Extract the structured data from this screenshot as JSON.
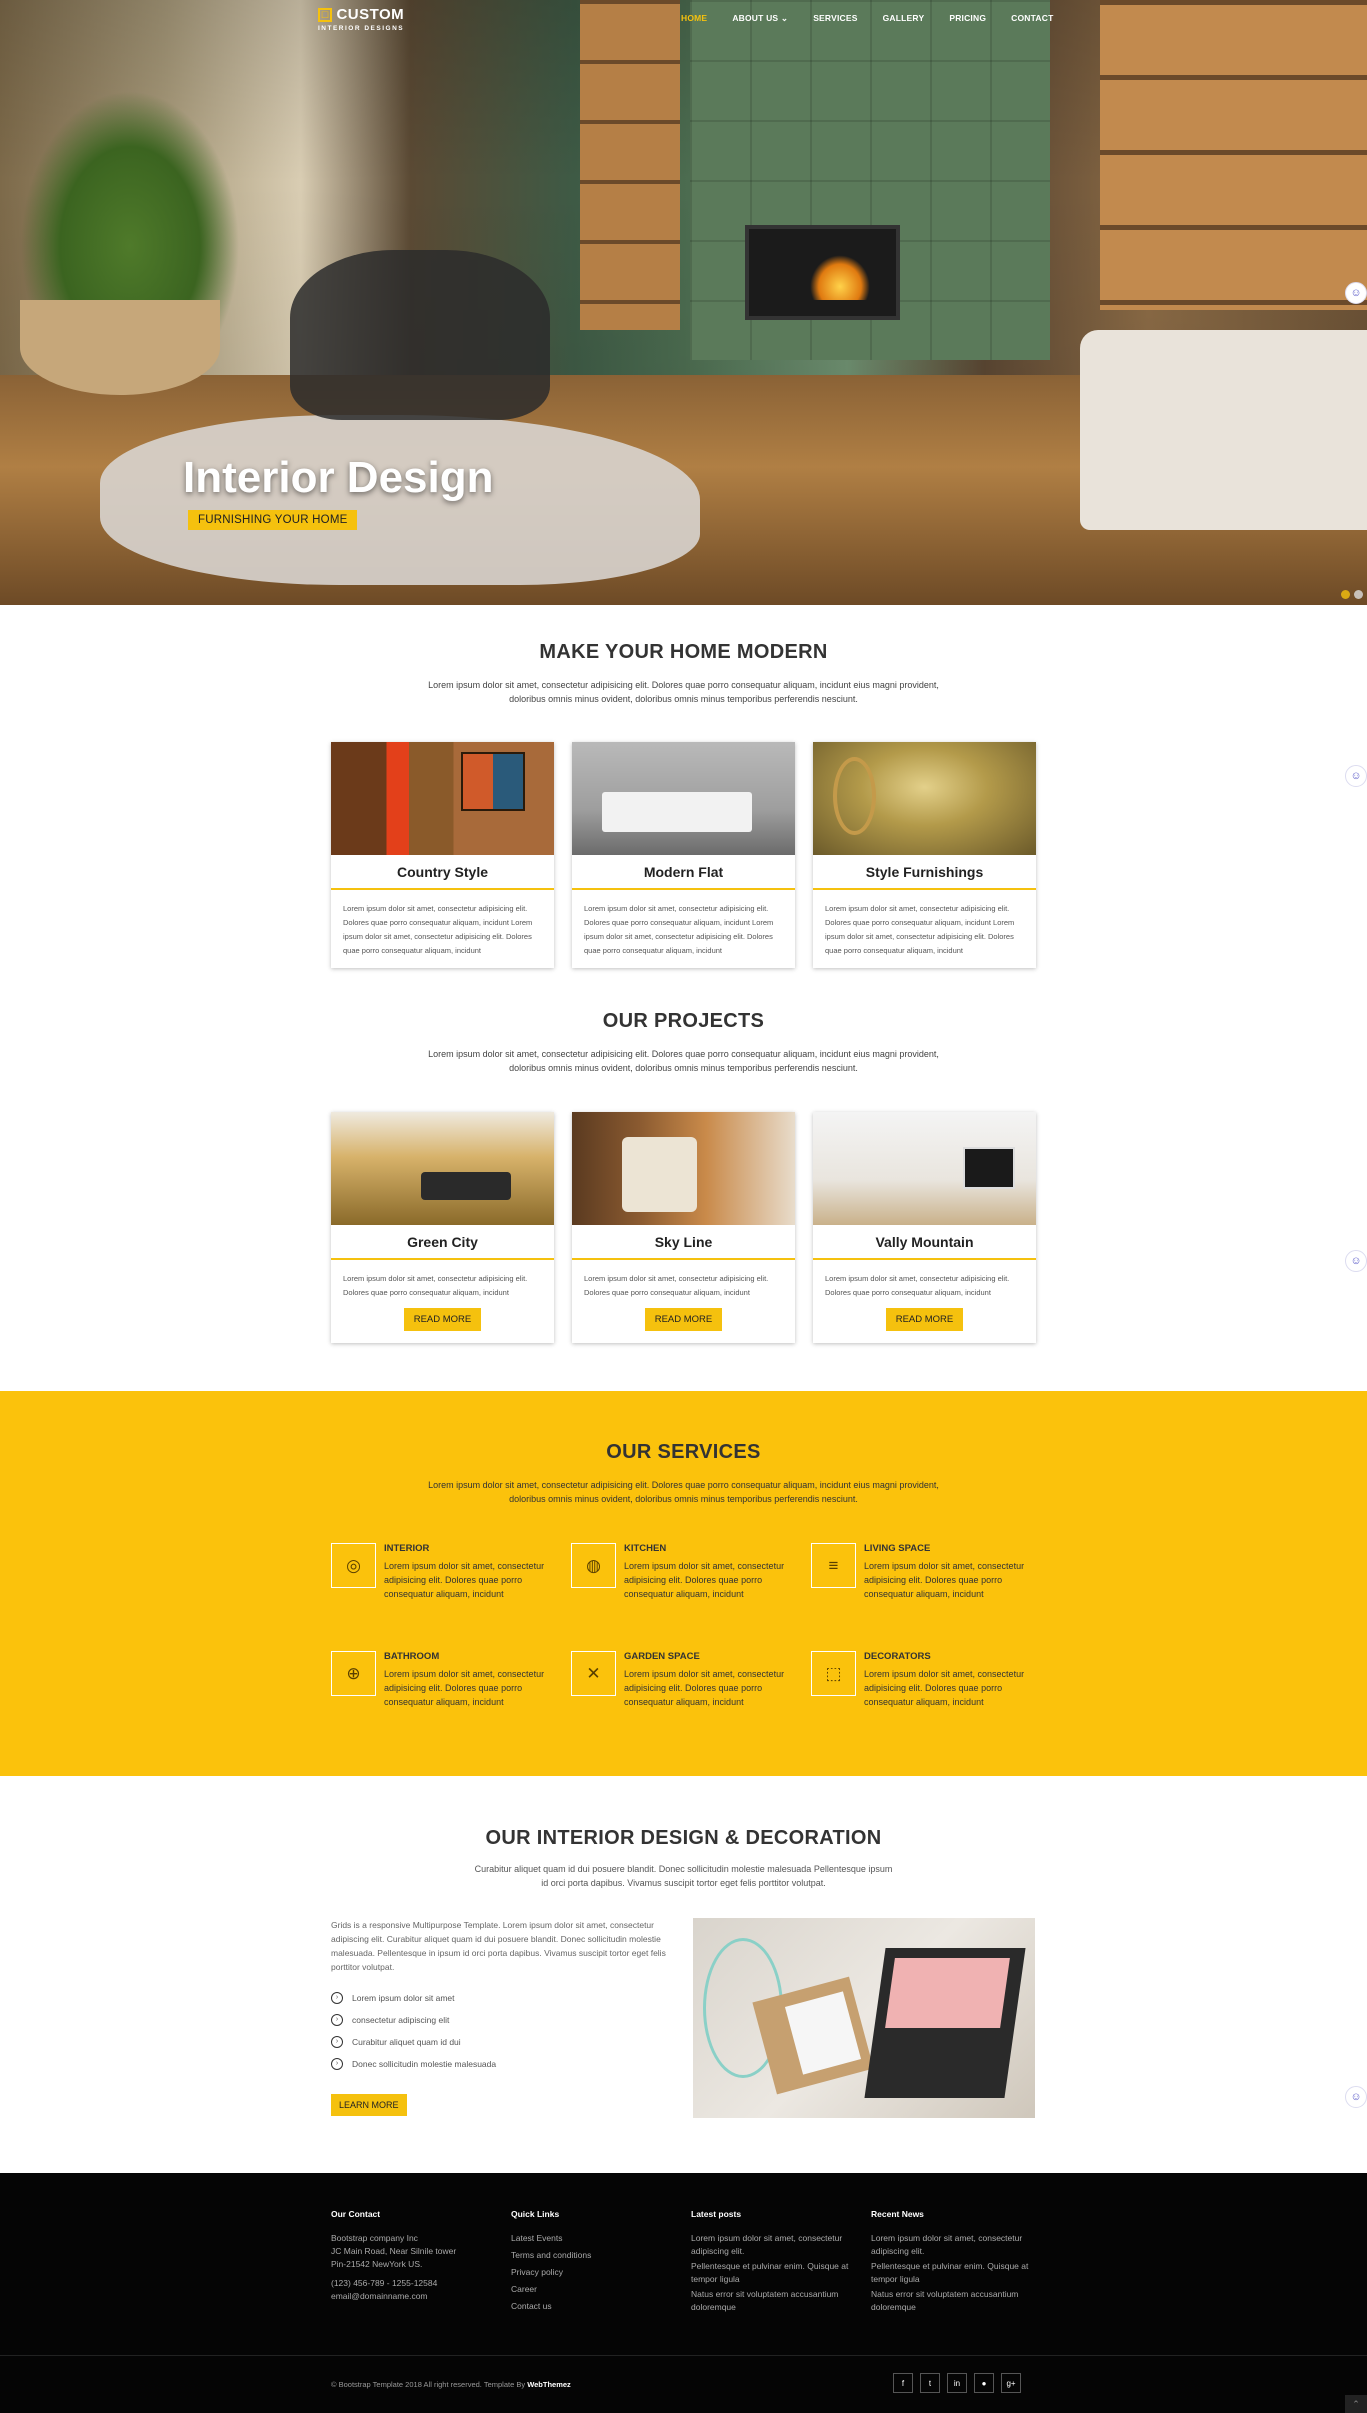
{
  "nav": {
    "logo_mark": "☐",
    "logo_name": "CUSTOM",
    "logo_sub": "INTERIOR DESIGNS",
    "items": [
      "HOME",
      "ABOUT US ⌄",
      "SERVICES",
      "GALLERY",
      "PRICING",
      "CONTACT"
    ]
  },
  "hero": {
    "title": "Interior Design",
    "badge": "FURNISHING YOUR HOME"
  },
  "modern": {
    "title": "MAKE YOUR HOME MODERN",
    "desc": "Lorem ipsum dolor sit amet, consectetur adipisicing elit. Dolores quae porro consequatur aliquam, incidunt eius magni provident, doloribus omnis minus ovident, doloribus omnis minus temporibus perferendis nesciunt.",
    "cards": [
      {
        "title": "Country Style",
        "text": "Lorem ipsum dolor sit amet, consectetur adipisicing elit. Dolores quae porro consequatur aliquam, incidunt Lorem ipsum dolor sit amet, consectetur adipisicing elit. Dolores quae porro consequatur aliquam, incidunt"
      },
      {
        "title": "Modern Flat",
        "text": "Lorem ipsum dolor sit amet, consectetur adipisicing elit. Dolores quae porro consequatur aliquam, incidunt Lorem ipsum dolor sit amet, consectetur adipisicing elit. Dolores quae porro consequatur aliquam, incidunt"
      },
      {
        "title": "Style Furnishings",
        "text": "Lorem ipsum dolor sit amet, consectetur adipisicing elit. Dolores quae porro consequatur aliquam, incidunt Lorem ipsum dolor sit amet, consectetur adipisicing elit. Dolores quae porro consequatur aliquam, incidunt"
      }
    ]
  },
  "projects": {
    "title": "OUR PROJECTS",
    "desc": "Lorem ipsum dolor sit amet, consectetur adipisicing elit. Dolores quae porro consequatur aliquam, incidunt eius magni provident, doloribus omnis minus ovident, doloribus omnis minus temporibus perferendis nesciunt.",
    "button_label": "READ MORE",
    "cards": [
      {
        "title": "Green City",
        "text": "Lorem ipsum dolor sit amet, consectetur adipisicing elit. Dolores quae porro consequatur aliquam, incidunt"
      },
      {
        "title": "Sky Line",
        "text": "Lorem ipsum dolor sit amet, consectetur adipisicing elit. Dolores quae porro consequatur aliquam, incidunt"
      },
      {
        "title": "Vally Mountain",
        "text": "Lorem ipsum dolor sit amet, consectetur adipisicing elit. Dolores quae porro consequatur aliquam, incidunt"
      }
    ]
  },
  "services": {
    "title": "OUR SERVICES",
    "desc": "Lorem ipsum dolor sit amet, consectetur adipisicing elit. Dolores quae porro consequatur aliquam, incidunt eius magni provident, doloribus omnis minus ovident, doloribus omnis minus temporibus perferendis nesciunt.",
    "items": [
      {
        "title": "INTERIOR",
        "text": "Lorem ipsum dolor sit amet, consectetur adipisicing elit. Dolores quae porro consequatur aliquam, incidunt",
        "icon": "◎"
      },
      {
        "title": "KITCHEN",
        "text": "Lorem ipsum dolor sit amet, consectetur adipisicing elit. Dolores quae porro consequatur aliquam, incidunt",
        "icon": "◍"
      },
      {
        "title": "LIVING SPACE",
        "text": "Lorem ipsum dolor sit amet, consectetur adipisicing elit. Dolores quae porro consequatur aliquam, incidunt",
        "icon": "≡"
      },
      {
        "title": "BATHROOM",
        "text": "Lorem ipsum dolor sit amet, consectetur adipisicing elit. Dolores quae porro consequatur aliquam, incidunt",
        "icon": "⊕"
      },
      {
        "title": "GARDEN SPACE",
        "text": "Lorem ipsum dolor sit amet, consectetur adipisicing elit. Dolores quae porro consequatur aliquam, incidunt",
        "icon": "✕"
      },
      {
        "title": "DECORATORS",
        "text": "Lorem ipsum dolor sit amet, consectetur adipisicing elit. Dolores quae porro consequatur aliquam, incidunt",
        "icon": "⬚"
      }
    ]
  },
  "interior": {
    "title": "OUR INTERIOR DESIGN & DECORATION",
    "desc": "Curabitur aliquet quam id dui posuere blandit. Donec sollicitudin molestie malesuada Pellentesque ipsum id orci porta dapibus. Vivamus suscipit tortor eget felis porttitor volutpat.",
    "para": "Grids is a responsive Multipurpose Template. Lorem ipsum dolor sit amet, consectetur adipiscing elit. Curabitur aliquet quam id dui posuere blandit. Donec sollicitudin molestie malesuada. Pellentesque in ipsum id orci porta dapibus. Vivamus suscipit tortor eget felis porttitor volutpat.",
    "list": [
      "Lorem ipsum dolor sit amet",
      "consectetur adipiscing elit",
      "Curabitur aliquet quam id dui",
      "Donec sollicitudin molestie malesuada"
    ],
    "button_label": "LEARN MORE"
  },
  "footer": {
    "contact": {
      "title": "Our Contact",
      "company": "Bootstrap company Inc",
      "address1": "JC Main Road, Near Silnile tower",
      "address2": "Pin-21542 NewYork US.",
      "phone": "(123) 456-789 - 1255-12584",
      "email": "email@domainname.com"
    },
    "quick": {
      "title": "Quick Links",
      "links": [
        "Latest Events",
        "Terms and conditions",
        "Privacy policy",
        "Career",
        "Contact us"
      ]
    },
    "posts": {
      "title": "Latest posts",
      "items": [
        "Lorem ipsum dolor sit amet, consectetur adipiscing elit.",
        "Pellentesque et pulvinar enim. Quisque at tempor ligula",
        "Natus error sit voluptatem accusantium doloremque"
      ]
    },
    "news": {
      "title": "Recent News",
      "items": [
        "Lorem ipsum dolor sit amet, consectetur adipiscing elit.",
        "Pellentesque et pulvinar enim. Quisque at tempor ligula",
        "Natus error sit voluptatem accusantium doloremque"
      ]
    },
    "copyright": "© Bootstrap Template 2018 All right reserved. Template By ",
    "brand": "WebThemez",
    "social": [
      "f",
      "t",
      "in",
      "●",
      "g+"
    ]
  },
  "colors": {
    "accent": "#fbc20c",
    "footer_bg": "#050505"
  }
}
